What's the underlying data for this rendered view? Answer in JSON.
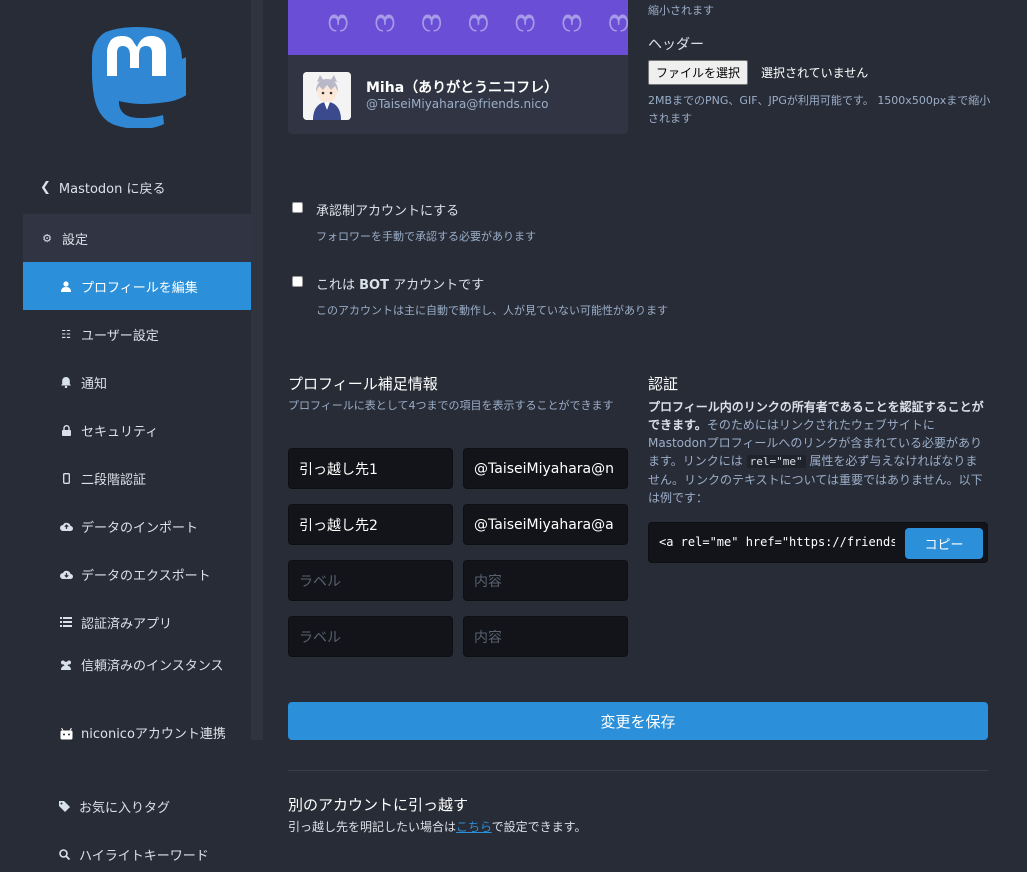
{
  "sidebar": {
    "back_label": "Mastodon に戻る",
    "settings_label": "設定",
    "items": [
      {
        "label": "プロフィールを編集",
        "icon": "user-icon",
        "active": true
      },
      {
        "label": "ユーザー設定",
        "icon": "sliders-icon"
      },
      {
        "label": "通知",
        "icon": "bell-icon"
      },
      {
        "label": "セキュリティ",
        "icon": "lock-icon"
      },
      {
        "label": "二段階認証",
        "icon": "mobile-icon"
      },
      {
        "label": "データのインポート",
        "icon": "cloud-upload-icon"
      },
      {
        "label": "データのエクスポート",
        "icon": "cloud-download-icon"
      },
      {
        "label": "認証済みアプリ",
        "icon": "list-icon"
      },
      {
        "label": "信頼済みのインスタンス",
        "icon": "users-icon"
      },
      {
        "label": "niconicoアカウント連携",
        "icon": "niconico-icon"
      },
      {
        "label": "お気に入りタグ",
        "icon": "tag-icon"
      },
      {
        "label": "ハイライトキーワード",
        "icon": "search-icon"
      }
    ]
  },
  "profile_card": {
    "name": "Miha（ありがとうニコフレ）",
    "handle": "@TaiseiMiyahara@friends.nico"
  },
  "avatar_hint_tail": "縮小されます",
  "header_upload": {
    "label": "ヘッダー",
    "button": "ファイルを選択",
    "status": "選択されていません",
    "hint": "2MBまでのPNG、GIF、JPGが利用可能です。 1500x500pxまで縮小されます"
  },
  "locked": {
    "label": "承認制アカウントにする",
    "hint": "フォロワーを手動で承認する必要があります"
  },
  "bot": {
    "label_pre": "これは ",
    "label_bold": "BOT",
    "label_post": " アカウントです",
    "hint": "このアカウントは主に自動で動作し、人が見ていない可能性があります"
  },
  "fields_section": {
    "title": "プロフィール補足情報",
    "hint": "プロフィールに表として4つまでの項目を表示することができます",
    "rows": [
      {
        "label": "引っ越し先1",
        "value": "@TaiseiMiyahara@n"
      },
      {
        "label": "引っ越し先2",
        "value": "@TaiseiMiyahara@a"
      },
      {
        "label_placeholder": "ラベル",
        "value_placeholder": "内容"
      },
      {
        "label_placeholder": "ラベル",
        "value_placeholder": "内容"
      }
    ]
  },
  "verification": {
    "title": "認証",
    "bold_text": "プロフィール内のリンクの所有者であることを認証することができます。",
    "text1": "そのためにはリンクされたウェブサイトにMastodonプロフィールへのリンクが含まれている必要があります。リンクには ",
    "code": "rel=\"me\"",
    "text2": " 属性を必ず与えなければなりません。リンクのテキストについては重要ではありません。以下は例です：",
    "code_sample": "<a rel=\"me\" href=\"https://friends.nico/@TaiseiMiyahara\">Mastodon</a>",
    "copy_button": "コピー"
  },
  "save_button": "変更を保存",
  "move": {
    "title": "別のアカウントに引っ越す",
    "text_pre": "引っ越し先を明記したい場合は",
    "link": "こちら",
    "text_post": "で設定できます。"
  }
}
